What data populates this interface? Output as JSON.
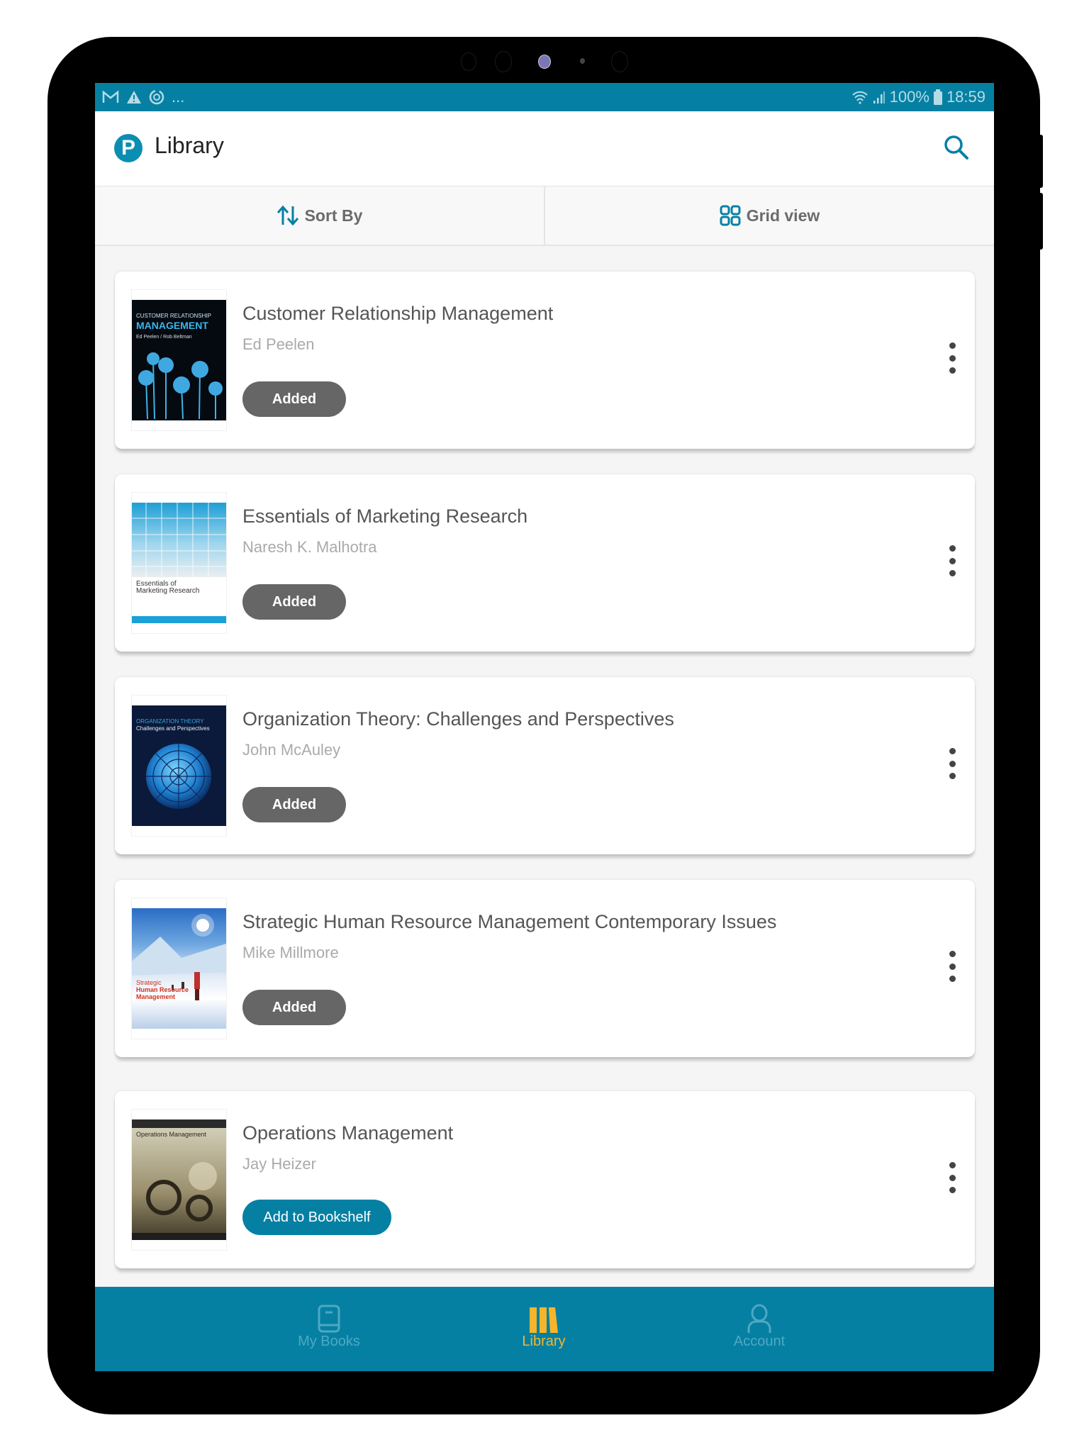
{
  "status_bar": {
    "left_icons": [
      "gmail-icon",
      "warning-icon",
      "sync-icon"
    ],
    "overflow": "...",
    "battery": "100%",
    "time": "18:59"
  },
  "header": {
    "title": "Library",
    "logo_letter": "P"
  },
  "toolbar": {
    "sort_label": "Sort By",
    "view_label": "Grid view"
  },
  "books": [
    {
      "title": "Customer Relationship Management",
      "author": "Ed Peelen",
      "action": "Added",
      "cover_title_top": "CUSTOMER RELATIONSHIP",
      "cover_title_main": "MANAGEMENT",
      "cover_authors": "Ed Peelen / Rob Beltman"
    },
    {
      "title": "Essentials of Marketing Research",
      "author": "Naresh K. Malhotra",
      "action": "Added",
      "cover_title_top": "Essentials of",
      "cover_title_main": "Marketing Research"
    },
    {
      "title": "Organization Theory: Challenges and Perspectives",
      "author": "John McAuley",
      "action": "Added",
      "cover_title_top": "ORGANIZATION THEORY",
      "cover_title_main": "Challenges and Perspectives"
    },
    {
      "title": "Strategic Human Resource Management Contemporary Issues",
      "author": "Mike Millmore",
      "action": "Added",
      "cover_title_top": "Strategic",
      "cover_title_main": "Human Resource Management"
    },
    {
      "title": "Operations Management",
      "author": "Jay Heizer",
      "action": "Add to Bookshelf",
      "cover_title_top": "Operations Management"
    }
  ],
  "bottom_nav": {
    "items": [
      {
        "label": "My Books",
        "icon": "book-icon",
        "active": false
      },
      {
        "label": "Library",
        "icon": "library-icon",
        "active": true
      },
      {
        "label": "Account",
        "icon": "account-icon",
        "active": false
      }
    ]
  },
  "colors": {
    "brand": "#0580a3",
    "active_nav": "#f6b52b",
    "added_button": "#666666"
  }
}
